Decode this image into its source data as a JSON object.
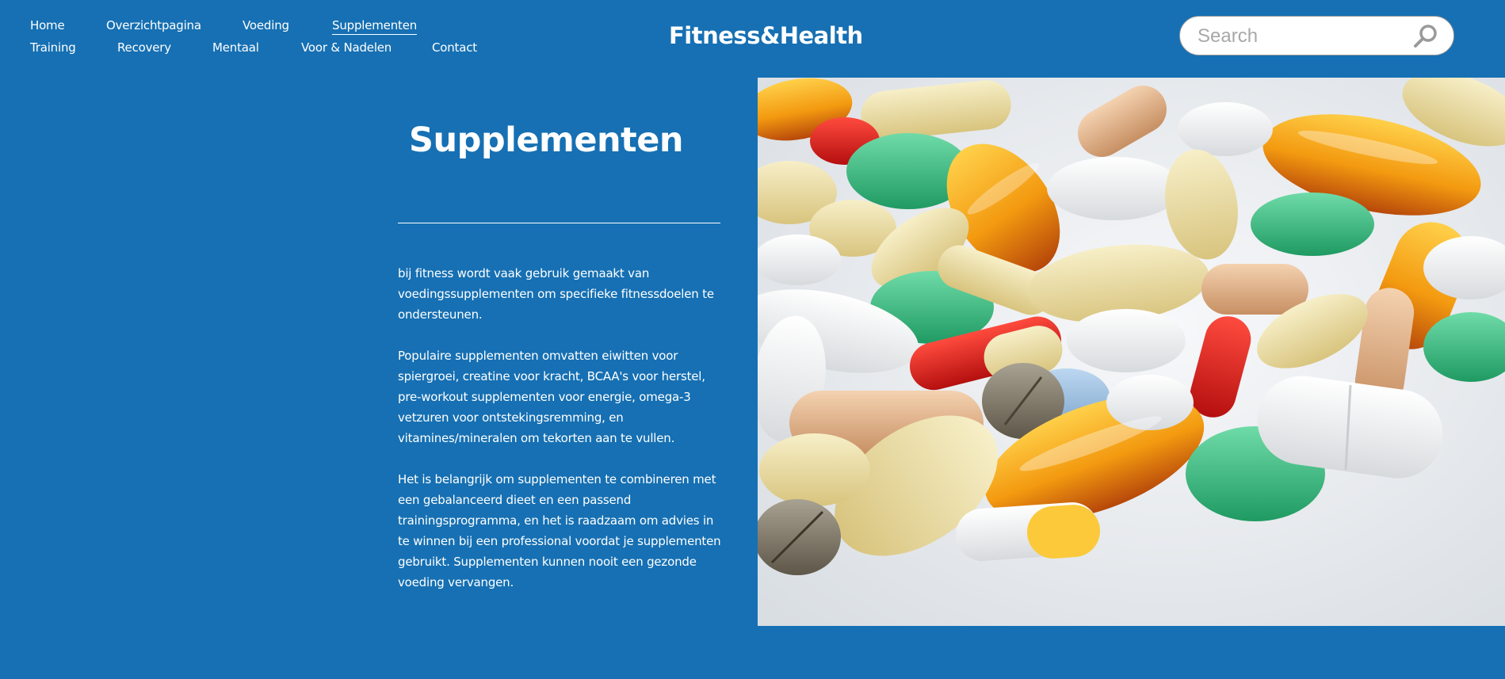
{
  "nav": {
    "row1": [
      "Home",
      "Overzichtpagina",
      "Voeding",
      "Supplementen"
    ],
    "row2": [
      "Training",
      "Recovery",
      "Mentaal",
      "Voor & Nadelen",
      "Contact"
    ],
    "active": "Supplementen"
  },
  "brand": "Fitness&Health",
  "search": {
    "placeholder": "Search",
    "value": ""
  },
  "main": {
    "title": "Supplementen",
    "paragraphs": [
      "bij fitness wordt vaak gebruik gemaakt van voedingssupplementen om specifieke fitnessdoelen te ondersteunen.",
      "Populaire supplementen omvatten eiwitten voor spiergroei, creatine voor kracht, BCAA's voor herstel, pre-workout supplementen voor energie, omega-3 vetzuren voor ontstekingsremming, en vitamines/mineralen om tekorten aan te vullen.",
      "Het is belangrijk om supplementen te combineren met een gebalanceerd dieet en een passend trainingsprogramma, en het is raadzaam om advies in te winnen bij een professional voordat je supplementen gebruikt. Supplementen kunnen nooit een gezonde voeding vervangen."
    ]
  },
  "colors": {
    "background": "#1670b3",
    "text": "#ffffff"
  },
  "icons": {
    "search": "magnifier-icon"
  }
}
